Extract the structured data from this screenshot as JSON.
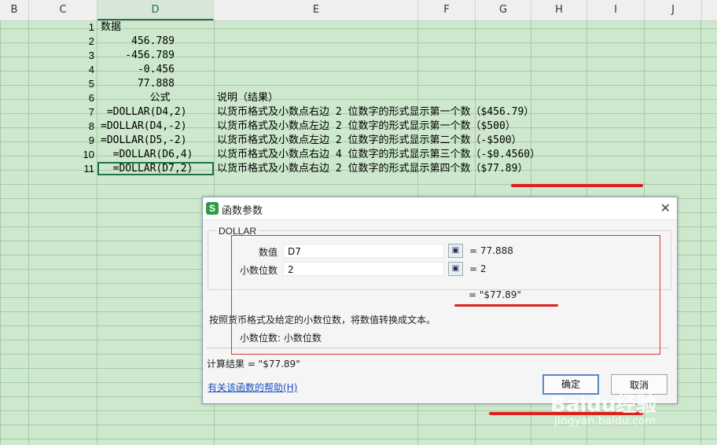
{
  "columns": [
    "B",
    "C",
    "D",
    "E",
    "F",
    "G",
    "H",
    "I",
    "J"
  ],
  "rows": [
    {
      "n": "1",
      "d": "数据",
      "e": ""
    },
    {
      "n": "2",
      "d": "     456.789",
      "e": ""
    },
    {
      "n": "3",
      "d": "    -456.789",
      "e": ""
    },
    {
      "n": "4",
      "d": "      -0.456",
      "e": ""
    },
    {
      "n": "5",
      "d": "      77.888",
      "e": ""
    },
    {
      "n": "6",
      "d": "        公式",
      "e": "说明（结果）"
    },
    {
      "n": "7",
      "d": " =DOLLAR(D4,2)",
      "e": "以货币格式及小数点右边 2 位数字的形式显示第一个数（$456.79）"
    },
    {
      "n": "8",
      "d": "=DOLLAR(D4,-2)",
      "e": "以货币格式及小数点左边 2 位数字的形式显示第一个数（$500）"
    },
    {
      "n": "9",
      "d": "=DOLLAR(D5,-2)",
      "e": "以货币格式及小数点左边 2 位数字的形式显示第二个数（-$500）"
    },
    {
      "n": "10",
      "d": "  =DOLLAR(D6,4)",
      "e": "以货币格式及小数点右边 4 位数字的形式显示第三个数（-$0.4560）"
    },
    {
      "n": "11",
      "d": "  =DOLLAR(D7,2)",
      "e": "以货币格式及小数点右边 2 位数字的形式显示第四个数（$77.89）"
    }
  ],
  "dialog": {
    "title": "函数参数",
    "close": "✕",
    "icon_letter": "S",
    "function_name": "DOLLAR",
    "field1_label": "数值",
    "field1_value": "D7",
    "field1_result": "=  77.888",
    "field2_label": "小数位数",
    "field2_value": "2",
    "field2_result": "=  2",
    "formula_result": "=  \"$77.89\"",
    "description": "按照货币格式及给定的小数位数，将数值转换成文本。",
    "param_help": "小数位数:   小数位数",
    "calc_result": "计算结果  =  \"$77.89\"",
    "help_link": "有关该函数的帮助(H)",
    "ok": "确定",
    "cancel": "取消"
  },
  "watermark": {
    "brand": "Baidu经验",
    "url": "jingyan.baidu.com"
  },
  "colors": {
    "accent": "#217346",
    "annotation": "#e02020"
  }
}
